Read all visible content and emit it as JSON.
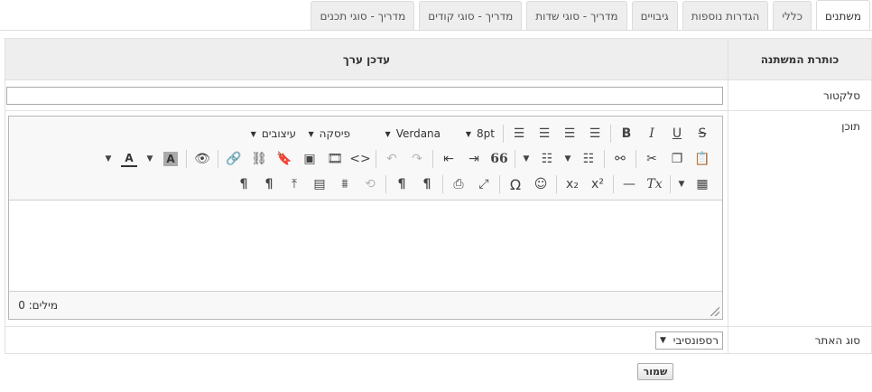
{
  "tabs": [
    {
      "label": "משתנים",
      "active": true
    },
    {
      "label": "כללי"
    },
    {
      "label": "הגדרות נוספות"
    },
    {
      "label": "גיבויים"
    },
    {
      "label": "מדריך - סוגי שדות"
    },
    {
      "label": "מדריך - סוגי קודים"
    },
    {
      "label": "מדריך - סוגי תכנים"
    }
  ],
  "table": {
    "col_label_header": "כותרת המשתנה",
    "col_value_header": "עדכן ערך",
    "rows": {
      "selector": {
        "label": "סלקטור",
        "value": ""
      },
      "content": {
        "label": "תוכן"
      },
      "site_type": {
        "label": "סוג האתר",
        "selected": "רספונסיבי"
      }
    }
  },
  "editor": {
    "font_size": "8pt",
    "font_name": "Verdana",
    "paragraph": "פיסקה",
    "styles": "עיצובים",
    "word_count": "מילים: 0"
  },
  "buttons": {
    "save": "שמור"
  },
  "icons": {
    "strike": "S",
    "underline": "U",
    "italic": "I",
    "bold": "B",
    "color_a": "A",
    "bg_a": "A",
    "omega": "Ω",
    "paragraph_mark": "¶",
    "source": "<>",
    "quote": "66",
    "sub": "x₂",
    "sup": "x²",
    "clear": "Tx"
  }
}
